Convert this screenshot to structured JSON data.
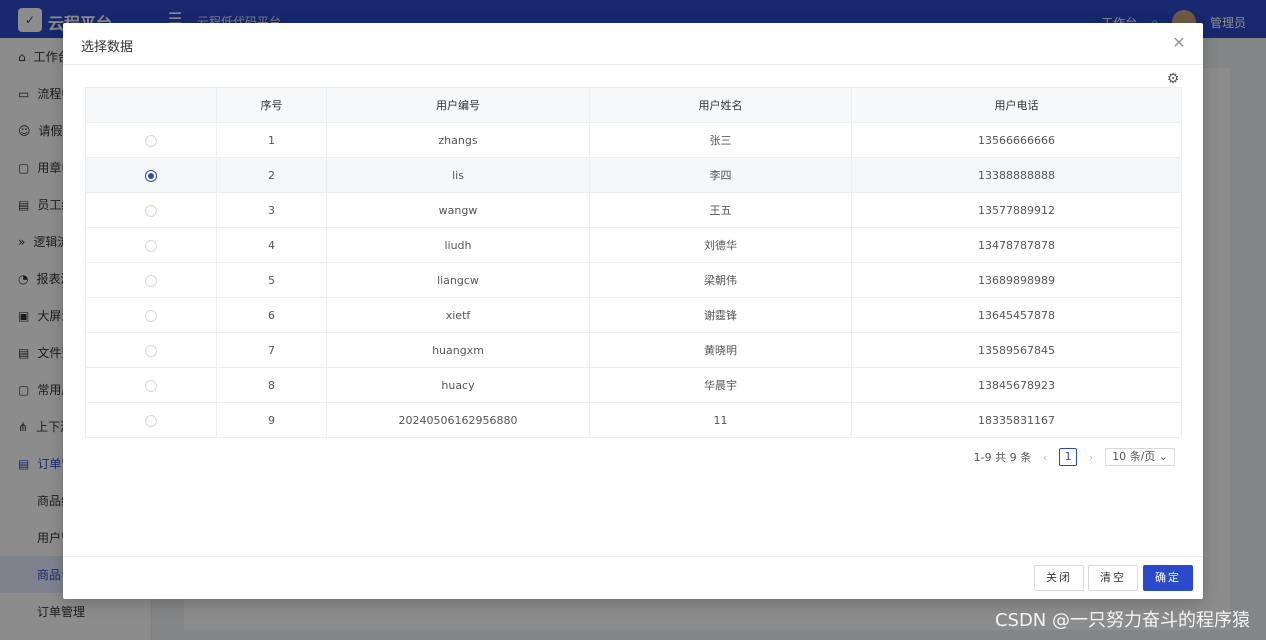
{
  "app": {
    "brand": "云程平台",
    "subtitle": "云程低代码平台",
    "top_right": [
      "工作台",
      "管理员"
    ]
  },
  "sidebar": {
    "items": [
      {
        "label": "工作台",
        "icon": "home-icon"
      },
      {
        "label": "流程中心",
        "icon": "monitor-icon"
      },
      {
        "label": "请假管理",
        "icon": "smile-icon"
      },
      {
        "label": "用章申请",
        "icon": "lock-icon"
      },
      {
        "label": "员工纪录",
        "icon": "doc-icon"
      },
      {
        "label": "逻辑流",
        "icon": "double-chevron-icon"
      },
      {
        "label": "报表演示",
        "icon": "pie-icon"
      },
      {
        "label": "大屏演示",
        "icon": "screen-icon"
      },
      {
        "label": "文件预览",
        "icon": "file-icon"
      },
      {
        "label": "常用应用",
        "icon": "bag-icon"
      },
      {
        "label": "上下游",
        "icon": "tree-icon"
      },
      {
        "label": "订单管理",
        "icon": "list-icon"
      }
    ],
    "sub_items": [
      "商品维护",
      "用户管理",
      "商品订单",
      "订单管理"
    ]
  },
  "modal": {
    "title": "选择数据",
    "columns": [
      "",
      "序号",
      "用户编号",
      "用户姓名",
      "用户电话"
    ],
    "rows": [
      {
        "index": "1",
        "code": "zhangs",
        "name": "张三",
        "phone": "13566666666",
        "selected": false
      },
      {
        "index": "2",
        "code": "lis",
        "name": "李四",
        "phone": "13388888888",
        "selected": true
      },
      {
        "index": "3",
        "code": "wangw",
        "name": "王五",
        "phone": "13577889912",
        "selected": false
      },
      {
        "index": "4",
        "code": "liudh",
        "name": "刘德华",
        "phone": "13478787878",
        "selected": false
      },
      {
        "index": "5",
        "code": "liangcw",
        "name": "梁朝伟",
        "phone": "13689898989",
        "selected": false
      },
      {
        "index": "6",
        "code": "xietf",
        "name": "谢霆锋",
        "phone": "13645457878",
        "selected": false
      },
      {
        "index": "7",
        "code": "huangxm",
        "name": "黄晓明",
        "phone": "13589567845",
        "selected": false
      },
      {
        "index": "8",
        "code": "huacy",
        "name": "华晨宇",
        "phone": "13845678923",
        "selected": false
      },
      {
        "index": "9",
        "code": "20240506162956880",
        "name": "11",
        "phone": "18335831167",
        "selected": false
      }
    ],
    "pagination": {
      "summary": "1-9 共 9 条",
      "current_page": "1",
      "page_size": "10 条/页"
    },
    "buttons": {
      "close": "关闭",
      "clear": "清空",
      "confirm": "确定"
    }
  },
  "watermark": "CSDN @一只努力奋斗的程序猿",
  "colors": {
    "primary": "#2b4acb",
    "header_bg": "#2b4acb"
  }
}
